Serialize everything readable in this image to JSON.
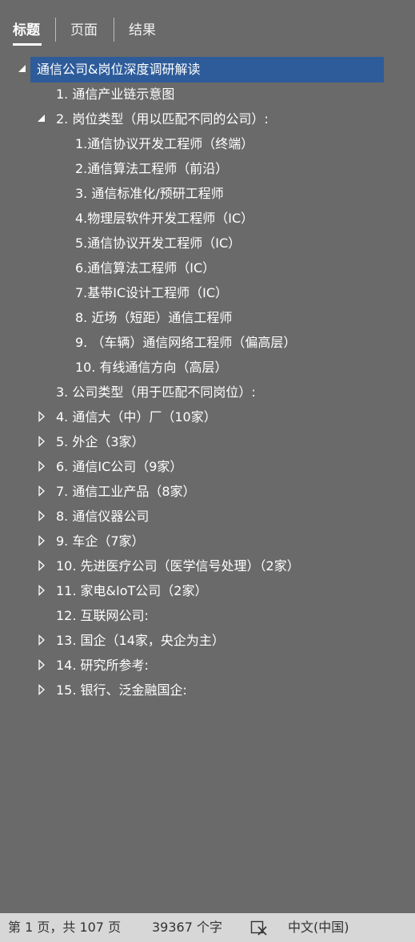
{
  "tabs": [
    {
      "label": "标题",
      "active": true
    },
    {
      "label": "页面",
      "active": false
    },
    {
      "label": "结果",
      "active": false
    }
  ],
  "tree": [
    {
      "label": "通信公司&岗位深度调研解读",
      "level": 0,
      "expander": "expanded",
      "selected": true
    },
    {
      "label": "1. 通信产业链示意图",
      "level": 1,
      "expander": "none"
    },
    {
      "label": "2. 岗位类型（用以匹配不同的公司）:",
      "level": 1,
      "expander": "expanded"
    },
    {
      "label": "1.通信协议开发工程师（终端）",
      "level": 2,
      "expander": "none"
    },
    {
      "label": "2.通信算法工程师（前沿）",
      "level": 2,
      "expander": "none"
    },
    {
      "label": "3. 通信标准化/预研工程师",
      "level": 2,
      "expander": "none"
    },
    {
      "label": "4.物理层软件开发工程师（IC）",
      "level": 2,
      "expander": "none"
    },
    {
      "label": "5.通信协议开发工程师（IC）",
      "level": 2,
      "expander": "none"
    },
    {
      "label": "6.通信算法工程师（IC）",
      "level": 2,
      "expander": "none"
    },
    {
      "label": "7.基带IC设计工程师（IC）",
      "level": 2,
      "expander": "none"
    },
    {
      "label": "8. 近场（短距）通信工程师",
      "level": 2,
      "expander": "none"
    },
    {
      "label": "9. （车辆）通信网络工程师（偏高层）",
      "level": 2,
      "expander": "none"
    },
    {
      "label": "10. 有线通信方向（高层）",
      "level": 2,
      "expander": "none"
    },
    {
      "label": "3. 公司类型（用于匹配不同岗位）:",
      "level": 1,
      "expander": "none"
    },
    {
      "label": "4. 通信大（中）厂（10家）",
      "level": 1,
      "expander": "collapsed"
    },
    {
      "label": "5. 外企（3家）",
      "level": 1,
      "expander": "collapsed"
    },
    {
      "label": "6. 通信IC公司（9家）",
      "level": 1,
      "expander": "collapsed"
    },
    {
      "label": "7. 通信工业产品（8家）",
      "level": 1,
      "expander": "collapsed"
    },
    {
      "label": "8. 通信仪器公司",
      "level": 1,
      "expander": "collapsed"
    },
    {
      "label": "9. 车企（7家）",
      "level": 1,
      "expander": "collapsed"
    },
    {
      "label": "10. 先进医疗公司（医学信号处理）（2家）",
      "level": 1,
      "expander": "collapsed"
    },
    {
      "label": "11. 家电&IoT公司（2家）",
      "level": 1,
      "expander": "collapsed"
    },
    {
      "label": "12. 互联网公司:",
      "level": 1,
      "expander": "none"
    },
    {
      "label": "13. 国企（14家，央企为主）",
      "level": 1,
      "expander": "collapsed"
    },
    {
      "label": "14. 研究所参考:",
      "level": 1,
      "expander": "collapsed"
    },
    {
      "label": "15. 银行、泛金融国企:",
      "level": 1,
      "expander": "collapsed"
    }
  ],
  "statusbar": {
    "page": "第 1 页，共 107 页",
    "word_count": "39367 个字",
    "proofing_icon": "proofing-icon",
    "language": "中文(中国)"
  },
  "colors": {
    "panel_bg": "#6a6a6a",
    "selected_bg": "#2e5c9a",
    "statusbar_bg": "#d7d7d7"
  }
}
